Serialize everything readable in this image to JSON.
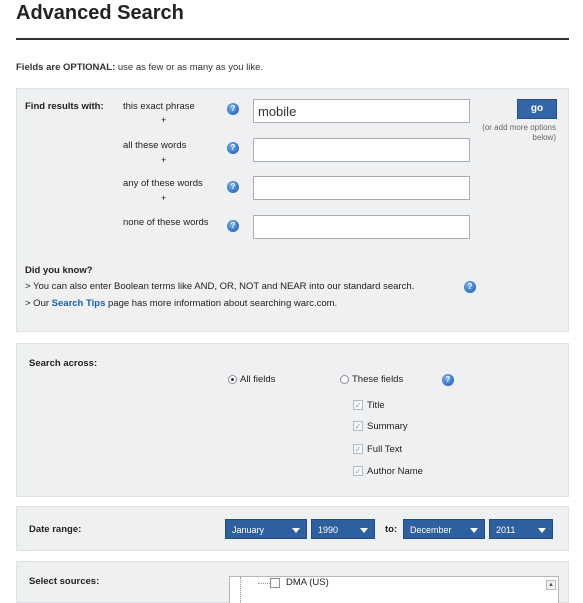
{
  "page": {
    "title": "Advanced Search",
    "optional_bold": "Fields are OPTIONAL:",
    "optional_rest": " use as few or as many as you like."
  },
  "find": {
    "label": "Find results with:",
    "rows": [
      {
        "label": "this exact phrase",
        "value": "mobile"
      },
      {
        "label": "all these words",
        "value": ""
      },
      {
        "label": "any of these words",
        "value": ""
      },
      {
        "label": "none of these words",
        "value": ""
      }
    ],
    "plus": "+",
    "go_label": "go",
    "go_note": "(or add more options below)"
  },
  "did_you_know": {
    "heading": "Did you know?",
    "line1": "> You can also enter Boolean terms like AND, OR, NOT and NEAR into our standard search.",
    "line2_pre": "> Our ",
    "line2_link": "Search Tips",
    "line2_post": " page has more information about searching warc.com."
  },
  "search_across": {
    "label": "Search across:",
    "all_fields": "All fields",
    "these_fields": "These fields",
    "selected": "All fields",
    "fields": [
      "Title",
      "Summary",
      "Full Text",
      "Author Name"
    ]
  },
  "date_range": {
    "label": "Date range:",
    "from_month": "January",
    "from_year": "1990",
    "to_label": "to:",
    "to_month": "December",
    "to_year": "2011"
  },
  "sources": {
    "label": "Select sources:",
    "first_item": "DMA (US)"
  },
  "icons": {
    "help": "help-icon",
    "help_color": "#2b6fc7",
    "accent": "#3467a8"
  }
}
